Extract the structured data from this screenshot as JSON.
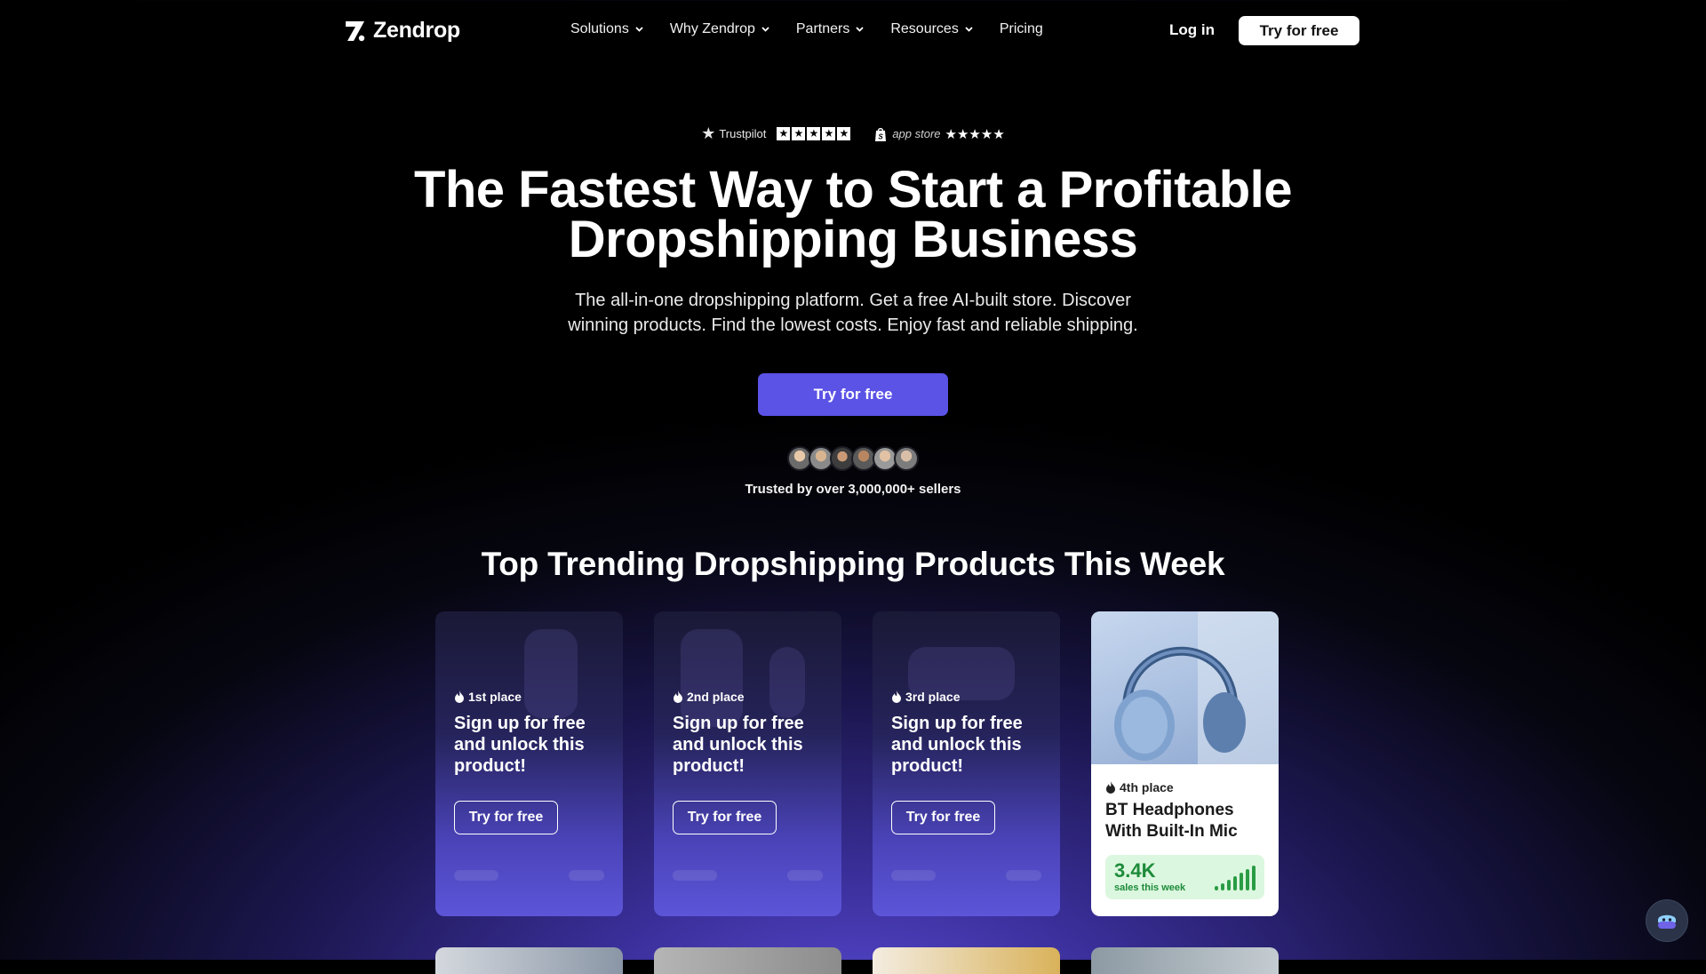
{
  "nav": {
    "brand": "Zendrop",
    "menu": [
      "Solutions",
      "Why Zendrop",
      "Partners",
      "Resources",
      "Pricing"
    ],
    "login": "Log in",
    "cta": "Try for free"
  },
  "ratings": {
    "trustpilot": "Trustpilot",
    "appstore": "app store"
  },
  "hero": {
    "title_line1": "The Fastest Way to Start a Profitable",
    "title_line2": "Dropshipping Business",
    "subtitle_line1": "The all-in-one dropshipping platform. Get a free AI-built store. Discover",
    "subtitle_line2": "winning products. Find the lowest costs. Enjoy fast and reliable shipping.",
    "cta": "Try for free",
    "trusted": "Trusted by over 3,000,000+ sellers"
  },
  "trending": {
    "title": "Top Trending Dropshipping Products This Week",
    "cards": [
      {
        "place": "1st place",
        "title": "Sign up for free and unlock this product!",
        "button": "Try for free"
      },
      {
        "place": "2nd place",
        "title": "Sign up for free and unlock this product!",
        "button": "Try for free"
      },
      {
        "place": "3rd place",
        "title": "Sign up for free and unlock this product!",
        "button": "Try for free"
      },
      {
        "place": "4th place",
        "title": "BT Headphones With Built-In Mic",
        "sales": "3.4K",
        "sales_label": "sales this week"
      }
    ]
  },
  "colors": {
    "accent": "#5b52e6",
    "sales_green": "#1d8b3a",
    "sales_bg": "#dcf7df"
  }
}
